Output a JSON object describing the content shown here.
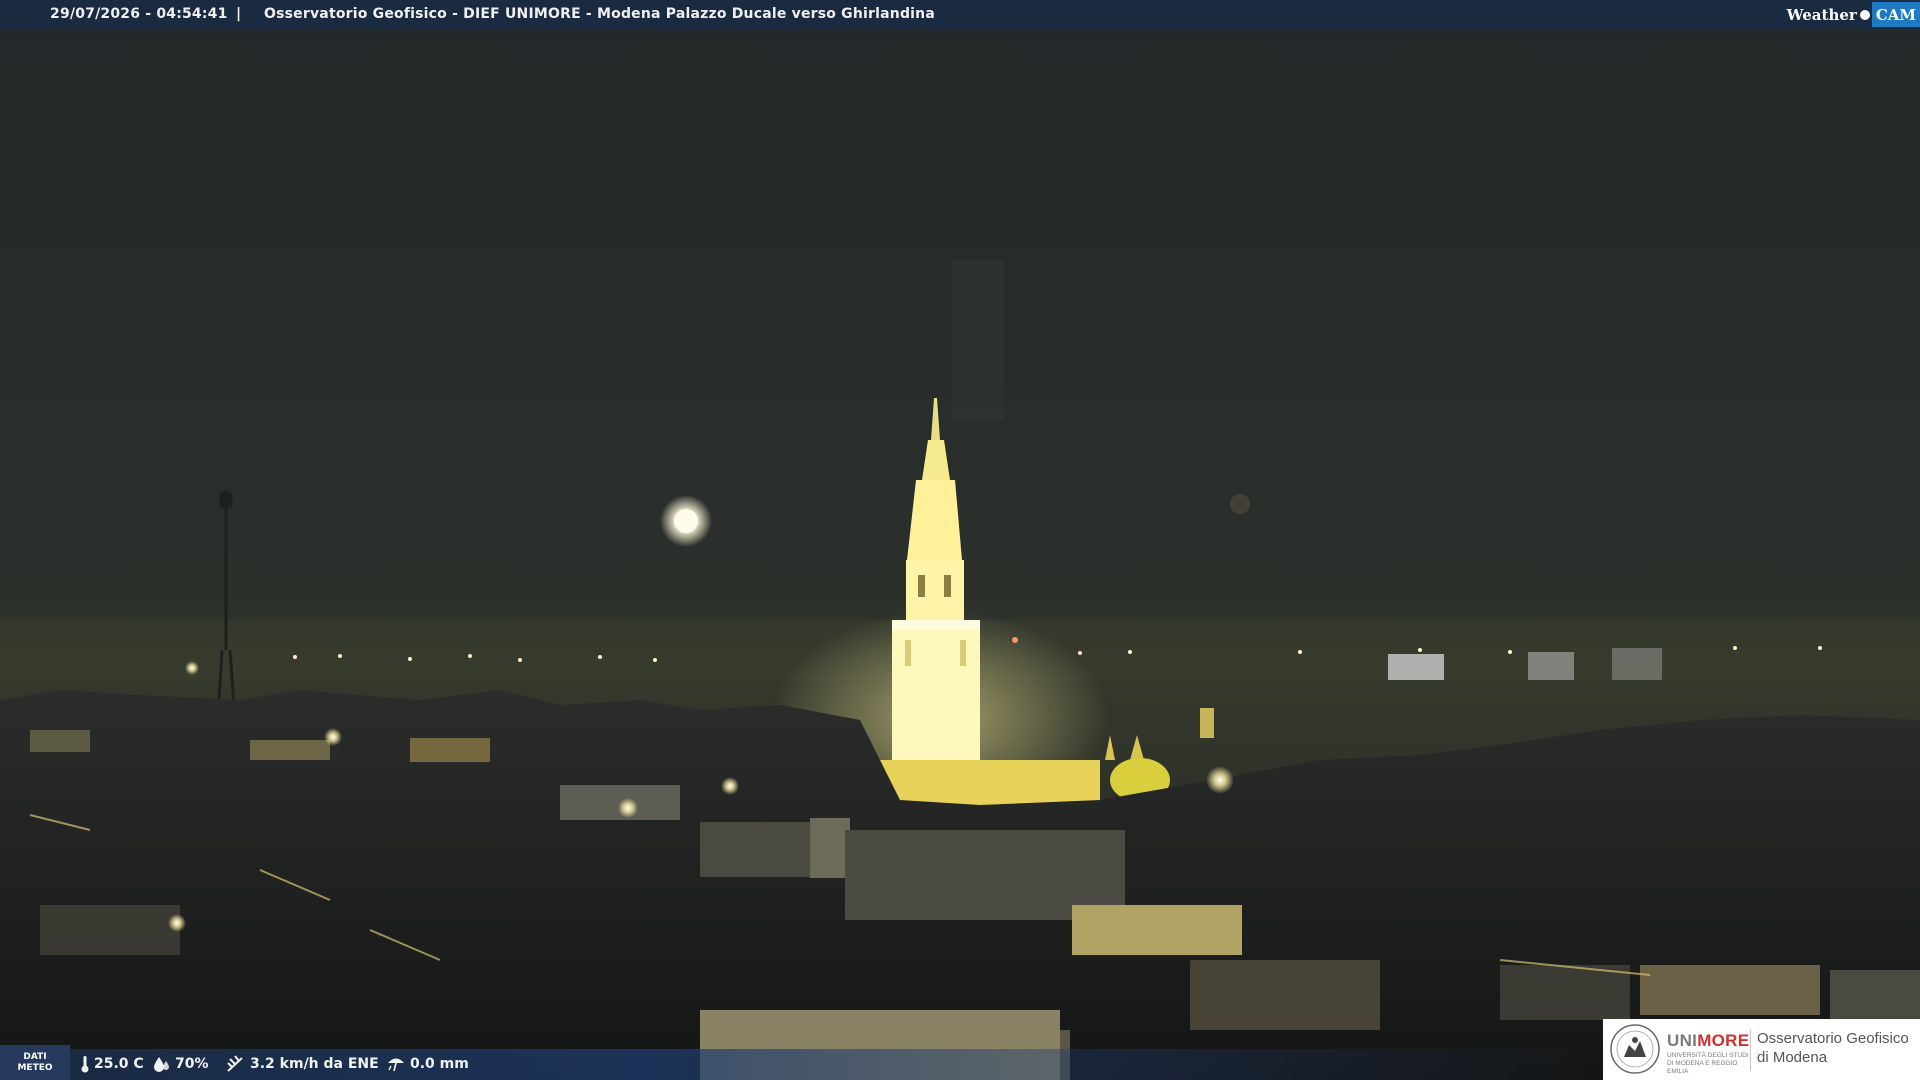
{
  "header": {
    "timestamp": "29/07/2026 - 04:54:41",
    "separator": "|",
    "location": "Osservatorio Geofisico - DIEF UNIMORE - Modena Palazzo Ducale verso Ghirlandina",
    "brand_weather": "Weather",
    "brand_cam": "CAM"
  },
  "weather_bar": {
    "label_line1": "DATI",
    "label_line2": "METEO",
    "temperature": "25.0 C",
    "humidity": "70%",
    "wind": "3.2 km/h da ENE",
    "rain": "0.0 mm",
    "icons": [
      "thermometer-icon",
      "humidity-drop-icon",
      "wind-icon",
      "rain-icon"
    ]
  },
  "logo": {
    "uni_part1": "UNI",
    "uni_part2": "MORE",
    "uni_subtitle": "UNIVERSITÀ DEGLI STUDI DI MODENA E REGGIO EMILIA",
    "observatory_line1": "Osservatorio Geofisico",
    "observatory_line2": "di Modena",
    "uni_color": "#d0312d"
  },
  "scene": {
    "sky_color": "#2a2f2a",
    "tower_light_color": "#fff6b0"
  }
}
